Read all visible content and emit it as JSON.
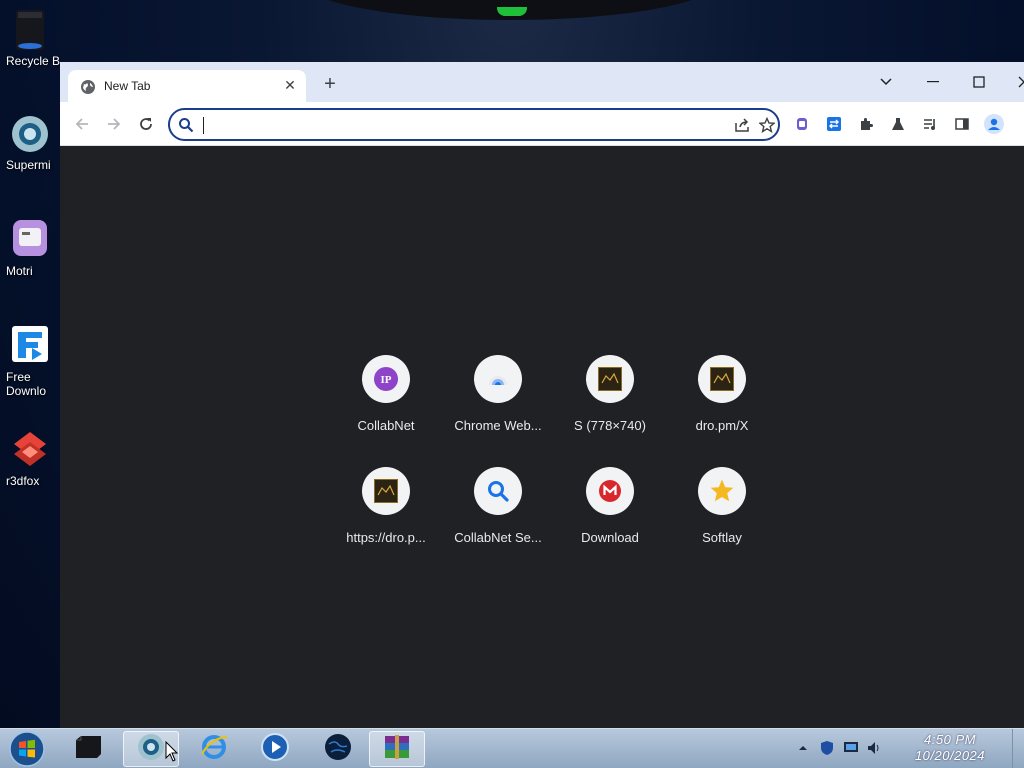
{
  "desktop": {
    "icons": [
      {
        "label": "Recycle B",
        "icon": "recycle-bin-icon"
      },
      {
        "label": "Supermi",
        "icon": "supermium-icon"
      },
      {
        "label": "Motri",
        "icon": "motrix-icon"
      },
      {
        "label": "Free Downlo",
        "label_line1": "Free",
        "label_line2": "Downlo",
        "icon": "free-download-manager-icon"
      },
      {
        "label": "r3dfox",
        "icon": "r3dfox-icon"
      }
    ]
  },
  "browser": {
    "tab": {
      "title": "New Tab",
      "icon": "globe-icon"
    },
    "new_tab_button": "+",
    "address_bar": {
      "value": "",
      "placeholder": ""
    },
    "content": {
      "shortcuts": [
        {
          "label": "CollabNet",
          "icon": "collabnet-ip-icon"
        },
        {
          "label": "Chrome Web...",
          "icon": "chrome-web-store-icon"
        },
        {
          "label": "S (778×740)",
          "icon": "thumbnail-image-icon"
        },
        {
          "label": "dro.pm/X",
          "icon": "thumbnail-image-icon"
        },
        {
          "label": "https://dro.p...",
          "icon": "thumbnail-image-icon"
        },
        {
          "label": "CollabNet Se...",
          "icon": "search-icon"
        },
        {
          "label": "Download",
          "icon": "mega-icon"
        },
        {
          "label": "Softlay",
          "icon": "star-icon"
        }
      ]
    }
  },
  "taskbar": {
    "clock": {
      "time": "4:50 PM",
      "date": "10/20/2024"
    },
    "apps": [
      "terminal-icon",
      "supermium-icon",
      "internet-explorer-icon",
      "media-player-icon",
      "globe-app-icon",
      "winrar-icon"
    ]
  },
  "colors": {
    "accent": "#1a3e8c",
    "ntp_background": "#202124",
    "titlebar": "#dfe6f5"
  }
}
